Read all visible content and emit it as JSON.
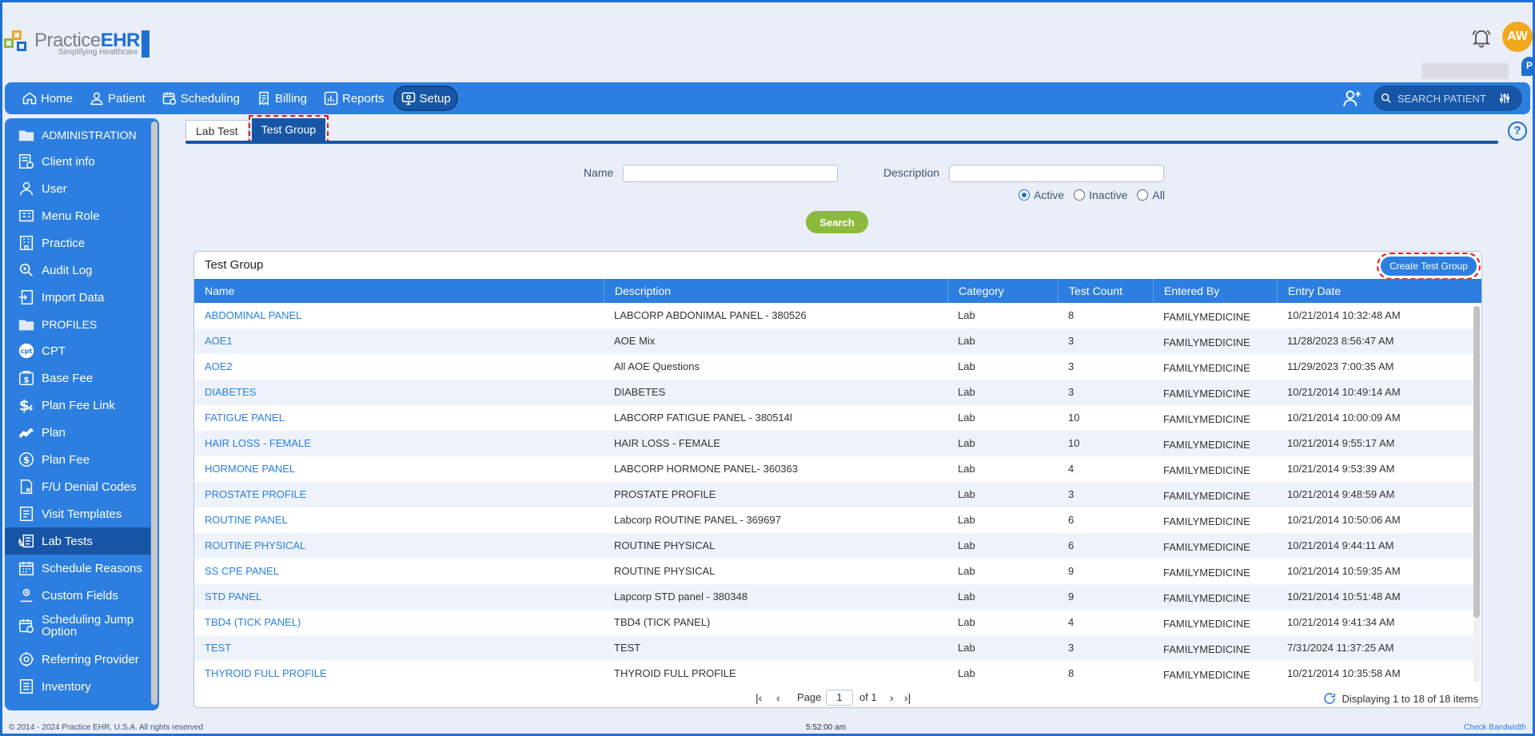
{
  "app": {
    "logo_text_a": "Practice",
    "logo_text_b": "EHR",
    "logo_tagline": "Simplifying Healthcare",
    "user_initials": "AW",
    "pin_letter": "P"
  },
  "nav": {
    "items": [
      {
        "label": "Home",
        "icon": "home-icon"
      },
      {
        "label": "Patient",
        "icon": "patient-icon"
      },
      {
        "label": "Scheduling",
        "icon": "scheduling-icon"
      },
      {
        "label": "Billing",
        "icon": "billing-icon"
      },
      {
        "label": "Reports",
        "icon": "reports-icon"
      },
      {
        "label": "Setup",
        "icon": "setup-icon",
        "active": true
      }
    ],
    "search_placeholder": "SEARCH PATIENT"
  },
  "sidebar": {
    "items": [
      {
        "label": "ADMINISTRATION",
        "section": true
      },
      {
        "label": "Client info"
      },
      {
        "label": "User"
      },
      {
        "label": "Menu Role"
      },
      {
        "label": "Practice"
      },
      {
        "label": "Audit Log"
      },
      {
        "label": "Import Data"
      },
      {
        "label": "PROFILES",
        "section": true
      },
      {
        "label": "CPT"
      },
      {
        "label": "Base Fee"
      },
      {
        "label": "Plan Fee Link"
      },
      {
        "label": "Plan"
      },
      {
        "label": "Plan Fee"
      },
      {
        "label": "F/U Denial Codes"
      },
      {
        "label": "Visit Templates"
      },
      {
        "label": "Lab Tests",
        "active": true
      },
      {
        "label": "Schedule Reasons"
      },
      {
        "label": "Custom Fields"
      },
      {
        "label": "Scheduling Jump Option"
      },
      {
        "label": "Referring Provider"
      },
      {
        "label": "Inventory"
      }
    ]
  },
  "tabs": [
    {
      "label": "Lab Test"
    },
    {
      "label": "Test Group",
      "active": true
    }
  ],
  "filters": {
    "name_label": "Name",
    "name_value": "",
    "description_label": "Description",
    "description_value": "",
    "radio_options": [
      "Active",
      "Inactive",
      "All"
    ],
    "radio_selected": "Active",
    "search_label": "Search"
  },
  "grid": {
    "title": "Test Group",
    "create_label": "Create Test Group",
    "columns": [
      "Name",
      "Description",
      "Category",
      "Test Count",
      "Entered By",
      "Entry Date"
    ],
    "rows": [
      [
        "ABDOMINAL PANEL",
        "LABCORP ABDONIMAL PANEL - 380526",
        "Lab",
        "8",
        "FAMILYMEDICINE",
        "10/21/2014 10:32:48 AM"
      ],
      [
        "AOE1",
        "AOE Mix",
        "Lab",
        "3",
        "FAMILYMEDICINE",
        "11/28/2023 8:56:47 AM"
      ],
      [
        "AOE2",
        "All AOE Questions",
        "Lab",
        "3",
        "FAMILYMEDICINE",
        "11/29/2023 7:00:35 AM"
      ],
      [
        "DIABETES",
        "DIABETES",
        "Lab",
        "3",
        "FAMILYMEDICINE",
        "10/21/2014 10:49:14 AM"
      ],
      [
        "FATIGUE PANEL",
        "LABCORP FATIGUE PANEL - 380514l",
        "Lab",
        "10",
        "FAMILYMEDICINE",
        "10/21/2014 10:00:09 AM"
      ],
      [
        "HAIR LOSS - FEMALE",
        "HAIR LOSS - FEMALE",
        "Lab",
        "10",
        "FAMILYMEDICINE",
        "10/21/2014 9:55:17 AM"
      ],
      [
        "HORMONE PANEL",
        "LABCORP HORMONE PANEL- 360363",
        "Lab",
        "4",
        "FAMILYMEDICINE",
        "10/21/2014 9:53:39 AM"
      ],
      [
        "PROSTATE PROFILE",
        "PROSTATE PROFILE",
        "Lab",
        "3",
        "FAMILYMEDICINE",
        "10/21/2014 9:48:59 AM"
      ],
      [
        "ROUTINE PANEL",
        "Labcorp ROUTINE PANEL - 369697",
        "Lab",
        "6",
        "FAMILYMEDICINE",
        "10/21/2014 10:50:06 AM"
      ],
      [
        "ROUTINE PHYSICAL",
        "ROUTINE PHYSICAL",
        "Lab",
        "6",
        "FAMILYMEDICINE",
        "10/21/2014 9:44:11 AM"
      ],
      [
        "SS CPE PANEL",
        "ROUTINE PHYSICAL",
        "Lab",
        "9",
        "FAMILYMEDICINE",
        "10/21/2014 10:59:35 AM"
      ],
      [
        "STD PANEL",
        "Lapcorp STD panel - 380348",
        "Lab",
        "9",
        "FAMILYMEDICINE",
        "10/21/2014 10:51:48 AM"
      ],
      [
        "TBD4 (TICK PANEL)",
        "TBD4 (TICK PANEL)",
        "Lab",
        "4",
        "FAMILYMEDICINE",
        "10/21/2014 9:41:34 AM"
      ],
      [
        "TEST",
        "TEST",
        "Lab",
        "3",
        "FAMILYMEDICINE",
        "7/31/2024 11:37:25 AM"
      ],
      [
        "THYROID FULL PROFILE",
        "THYROID FULL PROFILE",
        "Lab",
        "8",
        "FAMILYMEDICINE",
        "10/21/2014 10:35:58 AM"
      ]
    ],
    "pager": {
      "page_label": "Page",
      "page_value": "1",
      "of_label": "of 1",
      "info": "Displaying 1 to 18 of 18 items"
    }
  },
  "footer": {
    "copyright": "© 2014 - 2024 Practice EHR, U.S.A. All rights reserved",
    "time": "5:52:00 am",
    "bandwidth": "Check Bandwidth"
  }
}
